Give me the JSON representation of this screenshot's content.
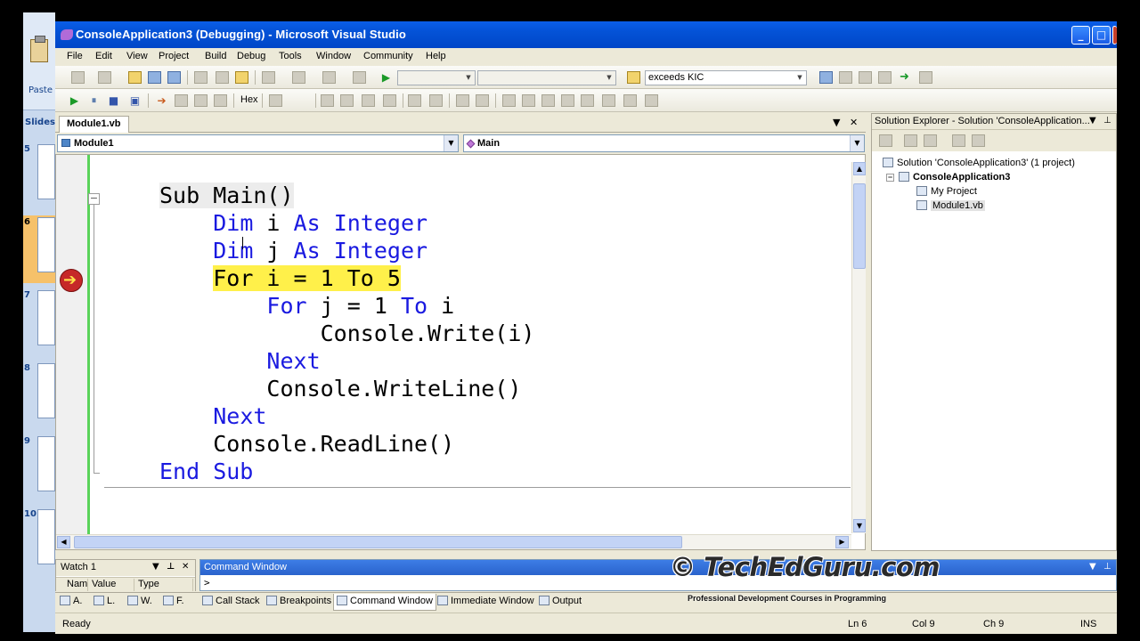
{
  "window": {
    "title": "ConsoleApplication3 (Debugging) - Microsoft Visual Studio",
    "accent": "#0452d6"
  },
  "powerpoint_strip": {
    "paste_label": "Paste",
    "slides_tab": "Slides",
    "slide_numbers": [
      "5",
      "6",
      "7",
      "8",
      "9",
      "10"
    ],
    "selected_slide": "6"
  },
  "menu": [
    "File",
    "Edit",
    "View",
    "Project",
    "Build",
    "Debug",
    "Tools",
    "Window",
    "Community",
    "Help"
  ],
  "toolbar": {
    "find_combo_value": "exceeds KIC",
    "hex_label": "Hex"
  },
  "document": {
    "tab_label": "Module1.vb",
    "nav_left": "Module1",
    "nav_right": "Main"
  },
  "code": [
    {
      "indent": 0,
      "tokens": [
        {
          "t": "Sub ",
          "c": "tx"
        },
        {
          "t": "Main()",
          "c": "tx"
        }
      ],
      "highlight": "sub"
    },
    {
      "indent": 1,
      "tokens": [
        {
          "t": "Dim",
          "c": "kw"
        },
        {
          "t": " i ",
          "c": "tx"
        },
        {
          "t": "As",
          "c": "kw"
        },
        {
          "t": " ",
          "c": "tx"
        },
        {
          "t": "Integer",
          "c": "kw"
        }
      ]
    },
    {
      "indent": 1,
      "tokens": [
        {
          "t": "Dim",
          "c": "kw"
        },
        {
          "t": " j ",
          "c": "tx"
        },
        {
          "t": "As",
          "c": "kw"
        },
        {
          "t": " ",
          "c": "tx"
        },
        {
          "t": "Integer",
          "c": "kw"
        }
      ]
    },
    {
      "indent": 1,
      "tokens": [
        {
          "t": "For i = 1 To 5",
          "c": "tx"
        }
      ],
      "highlight": "current"
    },
    {
      "indent": 2,
      "tokens": [
        {
          "t": "For",
          "c": "kw"
        },
        {
          "t": " j = 1 ",
          "c": "tx"
        },
        {
          "t": "To",
          "c": "kw"
        },
        {
          "t": " i",
          "c": "tx"
        }
      ]
    },
    {
      "indent": 3,
      "tokens": [
        {
          "t": "Console.Write(i)",
          "c": "tx"
        }
      ]
    },
    {
      "indent": 2,
      "tokens": [
        {
          "t": "Next",
          "c": "kw"
        }
      ]
    },
    {
      "indent": 2,
      "tokens": [
        {
          "t": "Console.WriteLine()",
          "c": "tx"
        }
      ]
    },
    {
      "indent": 1,
      "tokens": [
        {
          "t": "Next",
          "c": "kw"
        }
      ]
    },
    {
      "indent": 1,
      "tokens": [
        {
          "t": "Console.ReadLine()",
          "c": "tx"
        }
      ]
    },
    {
      "indent": 0,
      "tokens": [
        {
          "t": "End Sub",
          "c": "kw"
        }
      ]
    }
  ],
  "solution_explorer": {
    "title": "Solution Explorer - Solution 'ConsoleApplication...",
    "solution_node": "Solution 'ConsoleApplication3' (1 project)",
    "project_node": "ConsoleApplication3",
    "my_project": "My Project",
    "module_file": "Module1.vb"
  },
  "watch": {
    "title": "Watch 1",
    "columns": [
      "Nam",
      "Value",
      "Type"
    ]
  },
  "command_window": {
    "title": "Command Window",
    "prompt": ">"
  },
  "bottom_tabs": [
    "A.",
    "L.",
    "W.",
    "F.",
    "Call Stack",
    "Breakpoints",
    "Command Window",
    "Immediate Window",
    "Output"
  ],
  "status": {
    "ready": "Ready",
    "ln": "Ln 6",
    "col": "Col 9",
    "ch": "Ch 9",
    "ins": "INS"
  },
  "watermark": {
    "text": "© TechEdGuru.com",
    "tagline": "Professional Development Courses in Programming"
  }
}
